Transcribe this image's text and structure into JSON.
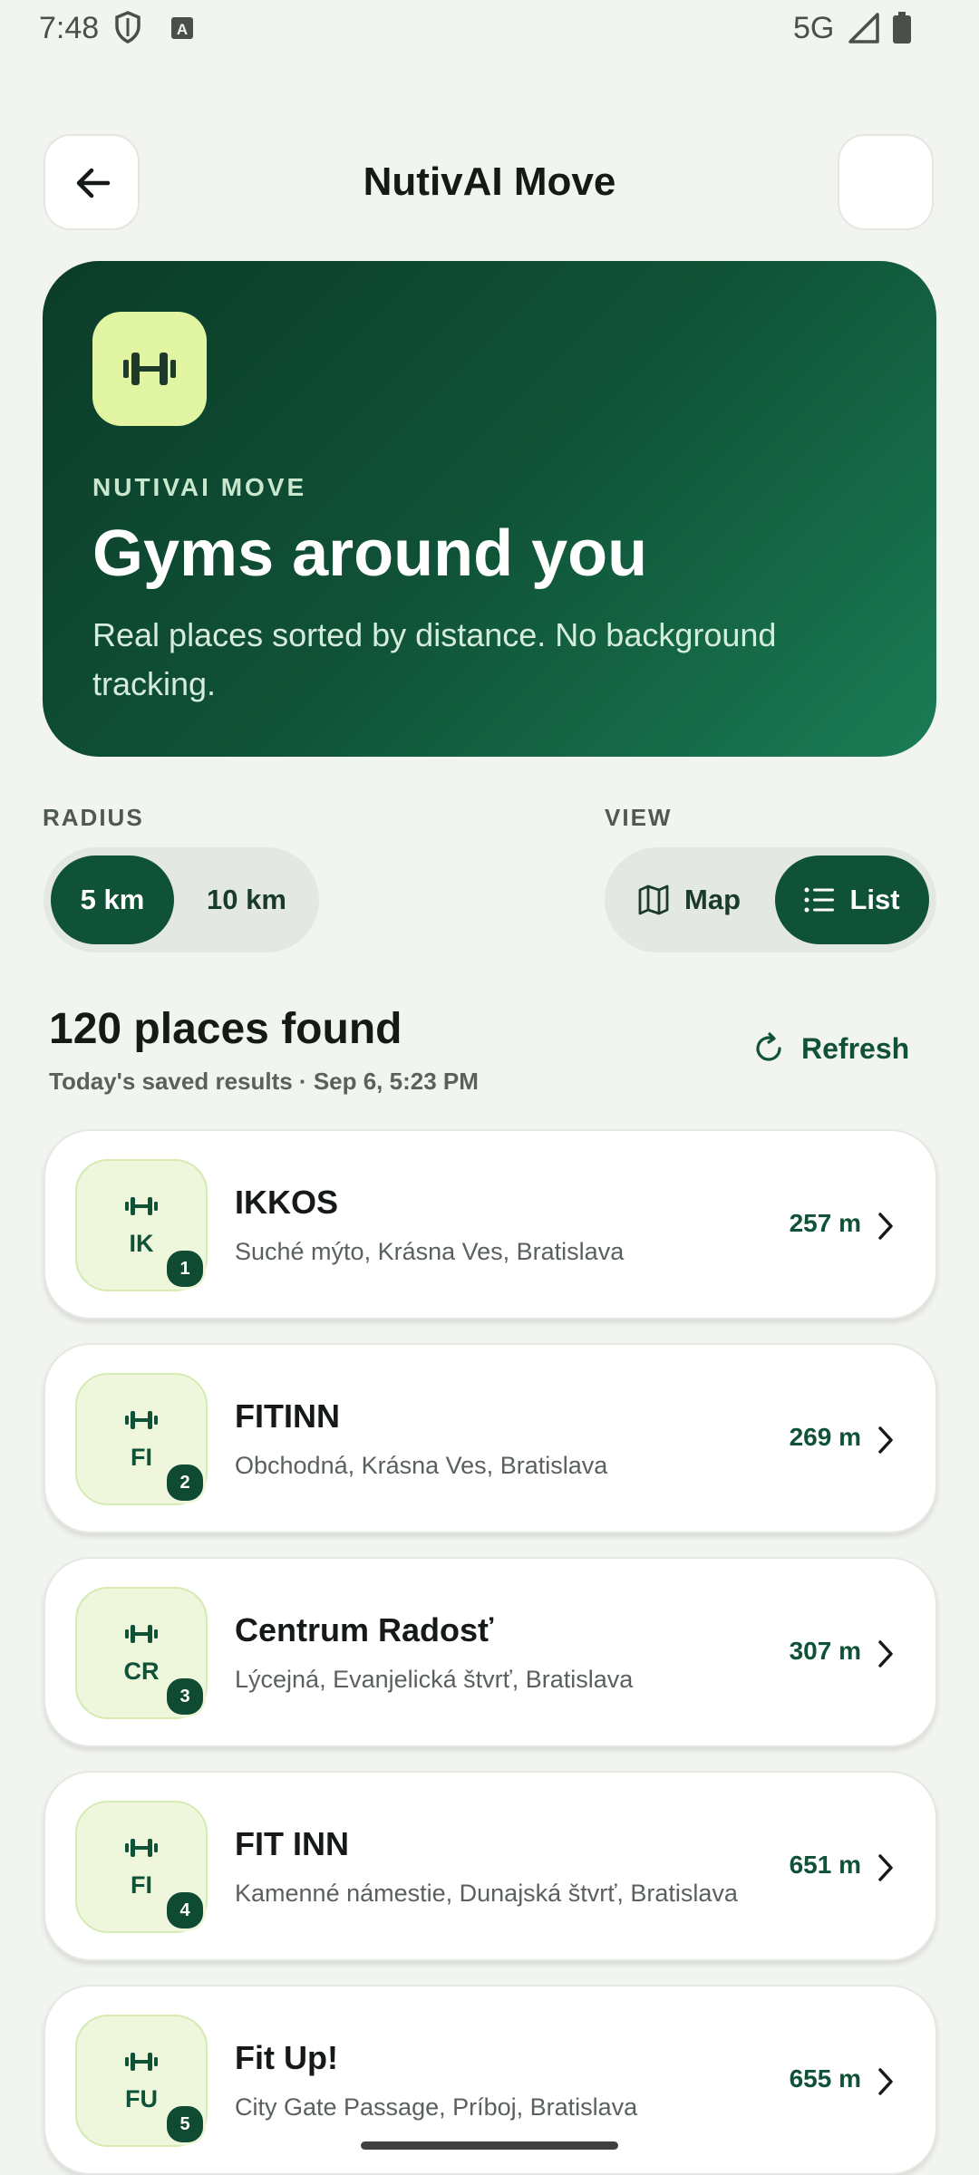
{
  "status_bar": {
    "time": "7:48",
    "network": "5G"
  },
  "header": {
    "title": "NutivAI Move"
  },
  "hero": {
    "eyebrow": "NUTIVAI MOVE",
    "title": "Gyms around you",
    "subtitle": "Real places sorted by distance. No background tracking."
  },
  "radius": {
    "label": "RADIUS",
    "options": [
      "5 km",
      "10 km"
    ],
    "selected": "5 km"
  },
  "view": {
    "label": "VIEW",
    "options": [
      "Map",
      "List"
    ],
    "selected": "List"
  },
  "results": {
    "count_text": "120 places found",
    "meta": "Today's saved results · Sep 6, 5:23 PM",
    "refresh_label": "Refresh"
  },
  "places": [
    {
      "initials": "IK",
      "rank": "1",
      "name": "IKKOS",
      "address": "Suché mýto, Krásna Ves, Bratislava",
      "distance": "257 m"
    },
    {
      "initials": "FI",
      "rank": "2",
      "name": "FITINN",
      "address": "Obchodná, Krásna Ves, Bratislava",
      "distance": "269 m"
    },
    {
      "initials": "CR",
      "rank": "3",
      "name": "Centrum Radosť",
      "address": "Lýcejná, Evanjelická štvrť, Bratislava",
      "distance": "307 m"
    },
    {
      "initials": "FI",
      "rank": "4",
      "name": "FIT INN",
      "address": "Kamenné námestie, Dunajská štvrť, Bratislava",
      "distance": "651 m"
    },
    {
      "initials": "FU",
      "rank": "5",
      "name": "Fit Up!",
      "address": "City Gate Passage, Príboj, Bratislava",
      "distance": "655 m"
    }
  ],
  "colors": {
    "primary": "#0f5237",
    "accent": "#e2f5a2",
    "background": "#f2f4f0"
  },
  "icons": {
    "back": "arrow-left-icon",
    "gym": "dumbbell-icon",
    "map": "map-icon",
    "list": "list-icon",
    "refresh": "refresh-icon",
    "chevron": "chevron-right-icon"
  }
}
